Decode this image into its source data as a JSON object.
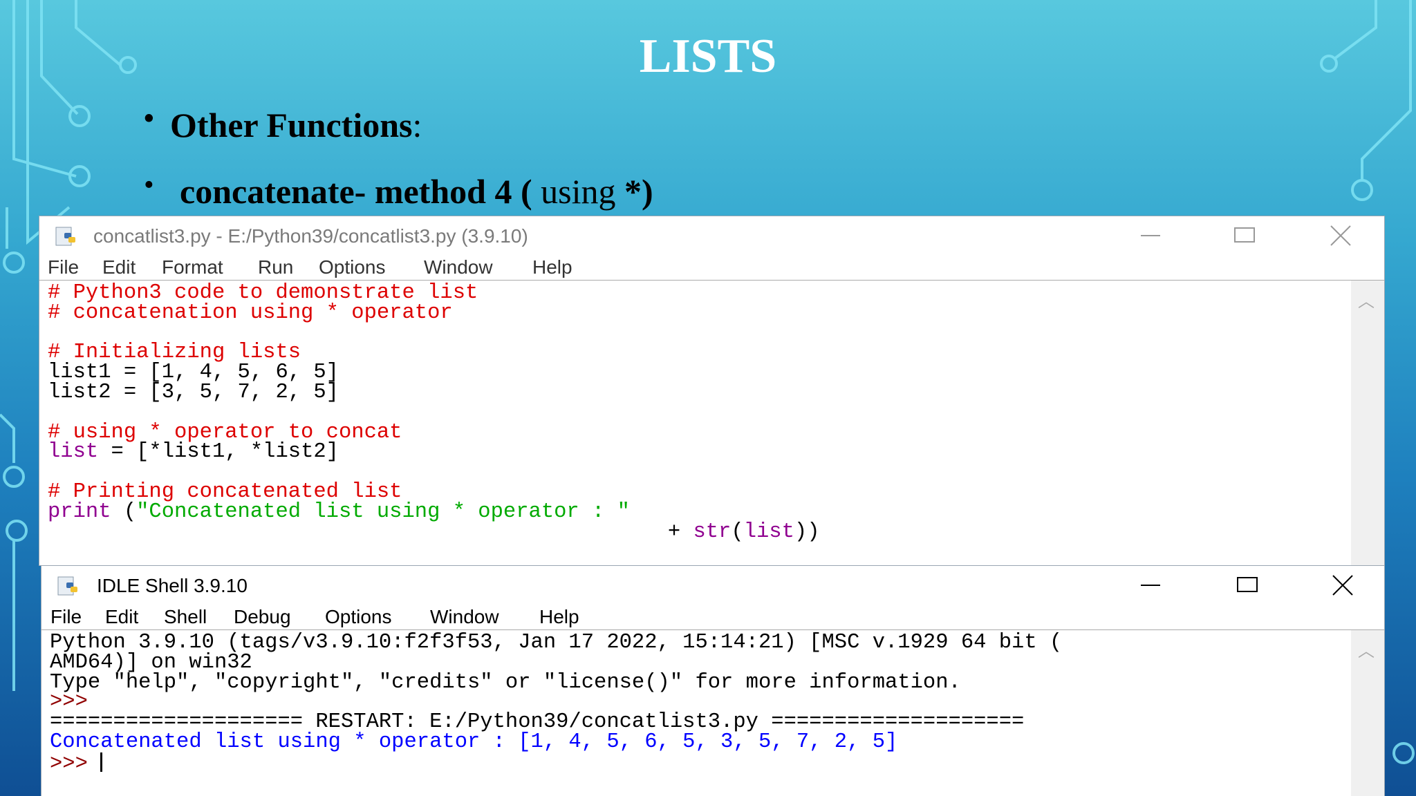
{
  "slide": {
    "title": "LISTS",
    "bullet1": "Other Functions",
    "bullet1_colon": ":",
    "bullet2_bold": "concatenate- method 4 (",
    "bullet2_normal": " using ",
    "bullet2_end": "*)"
  },
  "editor": {
    "title": "concatlist3.py - E:/Python39/concatlist3.py (3.9.10)",
    "menu": [
      "File",
      "Edit",
      "Format",
      "Run",
      "Options",
      "Window",
      "Help"
    ],
    "code": {
      "l1": "# Python3 code to demonstrate list",
      "l2": "# concatenation using * operator",
      "l4": "# Initializing lists",
      "l5": "list1 = [1, 4, 5, 6, 5]",
      "l6": "list2 = [3, 5, 7, 2, 5]",
      "l8": "# using * operator to concat",
      "l9_kw": "list",
      "l9_rest": " = [*list1, *list2]",
      "l11": "# Printing concatenated list",
      "l12_kw": "print",
      "l12_paren": " (",
      "l12_str": "\"Concatenated list using * operator : \"",
      "l13_pad": "                                                 + ",
      "l13_fn": "str",
      "l13_arg": "(",
      "l13_kw": "list",
      "l13_end": "))"
    }
  },
  "shell": {
    "title": "IDLE Shell 3.9.10",
    "menu": [
      "File",
      "Edit",
      "Shell",
      "Debug",
      "Options",
      "Window",
      "Help"
    ],
    "lines": {
      "l1": "Python 3.9.10 (tags/v3.9.10:f2f3f53, Jan 17 2022, 15:14:21) [MSC v.1929 64 bit (",
      "l2": "AMD64)] on win32",
      "l3": "Type \"help\", \"copyright\", \"credits\" or \"license()\" for more information.",
      "prompt": ">>>",
      "restart": "==================== RESTART: E:/Python39/concatlist3.py ====================",
      "output": "Concatenated list using * operator : [1, 4, 5, 6, 5, 3, 5, 7, 2, 5]",
      "prompt2": ">>> "
    }
  },
  "colors": {
    "comment": "#dd0000",
    "keyword": "#900090",
    "string": "#00aa00",
    "output": "#0000ff"
  }
}
